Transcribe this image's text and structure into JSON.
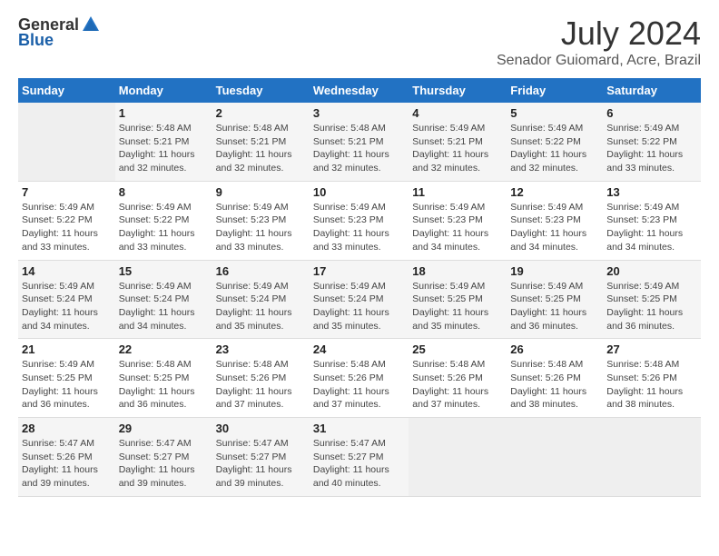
{
  "header": {
    "logo_general": "General",
    "logo_blue": "Blue",
    "title": "July 2024",
    "subtitle": "Senador Guiomard, Acre, Brazil"
  },
  "calendar": {
    "days_of_week": [
      "Sunday",
      "Monday",
      "Tuesday",
      "Wednesday",
      "Thursday",
      "Friday",
      "Saturday"
    ],
    "weeks": [
      [
        {
          "day": "",
          "info": ""
        },
        {
          "day": "1",
          "info": "Sunrise: 5:48 AM\nSunset: 5:21 PM\nDaylight: 11 hours\nand 32 minutes."
        },
        {
          "day": "2",
          "info": "Sunrise: 5:48 AM\nSunset: 5:21 PM\nDaylight: 11 hours\nand 32 minutes."
        },
        {
          "day": "3",
          "info": "Sunrise: 5:48 AM\nSunset: 5:21 PM\nDaylight: 11 hours\nand 32 minutes."
        },
        {
          "day": "4",
          "info": "Sunrise: 5:49 AM\nSunset: 5:21 PM\nDaylight: 11 hours\nand 32 minutes."
        },
        {
          "day": "5",
          "info": "Sunrise: 5:49 AM\nSunset: 5:22 PM\nDaylight: 11 hours\nand 32 minutes."
        },
        {
          "day": "6",
          "info": "Sunrise: 5:49 AM\nSunset: 5:22 PM\nDaylight: 11 hours\nand 33 minutes."
        }
      ],
      [
        {
          "day": "7",
          "info": "Sunrise: 5:49 AM\nSunset: 5:22 PM\nDaylight: 11 hours\nand 33 minutes."
        },
        {
          "day": "8",
          "info": "Sunrise: 5:49 AM\nSunset: 5:22 PM\nDaylight: 11 hours\nand 33 minutes."
        },
        {
          "day": "9",
          "info": "Sunrise: 5:49 AM\nSunset: 5:23 PM\nDaylight: 11 hours\nand 33 minutes."
        },
        {
          "day": "10",
          "info": "Sunrise: 5:49 AM\nSunset: 5:23 PM\nDaylight: 11 hours\nand 33 minutes."
        },
        {
          "day": "11",
          "info": "Sunrise: 5:49 AM\nSunset: 5:23 PM\nDaylight: 11 hours\nand 34 minutes."
        },
        {
          "day": "12",
          "info": "Sunrise: 5:49 AM\nSunset: 5:23 PM\nDaylight: 11 hours\nand 34 minutes."
        },
        {
          "day": "13",
          "info": "Sunrise: 5:49 AM\nSunset: 5:23 PM\nDaylight: 11 hours\nand 34 minutes."
        }
      ],
      [
        {
          "day": "14",
          "info": "Sunrise: 5:49 AM\nSunset: 5:24 PM\nDaylight: 11 hours\nand 34 minutes."
        },
        {
          "day": "15",
          "info": "Sunrise: 5:49 AM\nSunset: 5:24 PM\nDaylight: 11 hours\nand 34 minutes."
        },
        {
          "day": "16",
          "info": "Sunrise: 5:49 AM\nSunset: 5:24 PM\nDaylight: 11 hours\nand 35 minutes."
        },
        {
          "day": "17",
          "info": "Sunrise: 5:49 AM\nSunset: 5:24 PM\nDaylight: 11 hours\nand 35 minutes."
        },
        {
          "day": "18",
          "info": "Sunrise: 5:49 AM\nSunset: 5:25 PM\nDaylight: 11 hours\nand 35 minutes."
        },
        {
          "day": "19",
          "info": "Sunrise: 5:49 AM\nSunset: 5:25 PM\nDaylight: 11 hours\nand 36 minutes."
        },
        {
          "day": "20",
          "info": "Sunrise: 5:49 AM\nSunset: 5:25 PM\nDaylight: 11 hours\nand 36 minutes."
        }
      ],
      [
        {
          "day": "21",
          "info": "Sunrise: 5:49 AM\nSunset: 5:25 PM\nDaylight: 11 hours\nand 36 minutes."
        },
        {
          "day": "22",
          "info": "Sunrise: 5:48 AM\nSunset: 5:25 PM\nDaylight: 11 hours\nand 36 minutes."
        },
        {
          "day": "23",
          "info": "Sunrise: 5:48 AM\nSunset: 5:26 PM\nDaylight: 11 hours\nand 37 minutes."
        },
        {
          "day": "24",
          "info": "Sunrise: 5:48 AM\nSunset: 5:26 PM\nDaylight: 11 hours\nand 37 minutes."
        },
        {
          "day": "25",
          "info": "Sunrise: 5:48 AM\nSunset: 5:26 PM\nDaylight: 11 hours\nand 37 minutes."
        },
        {
          "day": "26",
          "info": "Sunrise: 5:48 AM\nSunset: 5:26 PM\nDaylight: 11 hours\nand 38 minutes."
        },
        {
          "day": "27",
          "info": "Sunrise: 5:48 AM\nSunset: 5:26 PM\nDaylight: 11 hours\nand 38 minutes."
        }
      ],
      [
        {
          "day": "28",
          "info": "Sunrise: 5:47 AM\nSunset: 5:26 PM\nDaylight: 11 hours\nand 39 minutes."
        },
        {
          "day": "29",
          "info": "Sunrise: 5:47 AM\nSunset: 5:27 PM\nDaylight: 11 hours\nand 39 minutes."
        },
        {
          "day": "30",
          "info": "Sunrise: 5:47 AM\nSunset: 5:27 PM\nDaylight: 11 hours\nand 39 minutes."
        },
        {
          "day": "31",
          "info": "Sunrise: 5:47 AM\nSunset: 5:27 PM\nDaylight: 11 hours\nand 40 minutes."
        },
        {
          "day": "",
          "info": ""
        },
        {
          "day": "",
          "info": ""
        },
        {
          "day": "",
          "info": ""
        }
      ]
    ]
  }
}
